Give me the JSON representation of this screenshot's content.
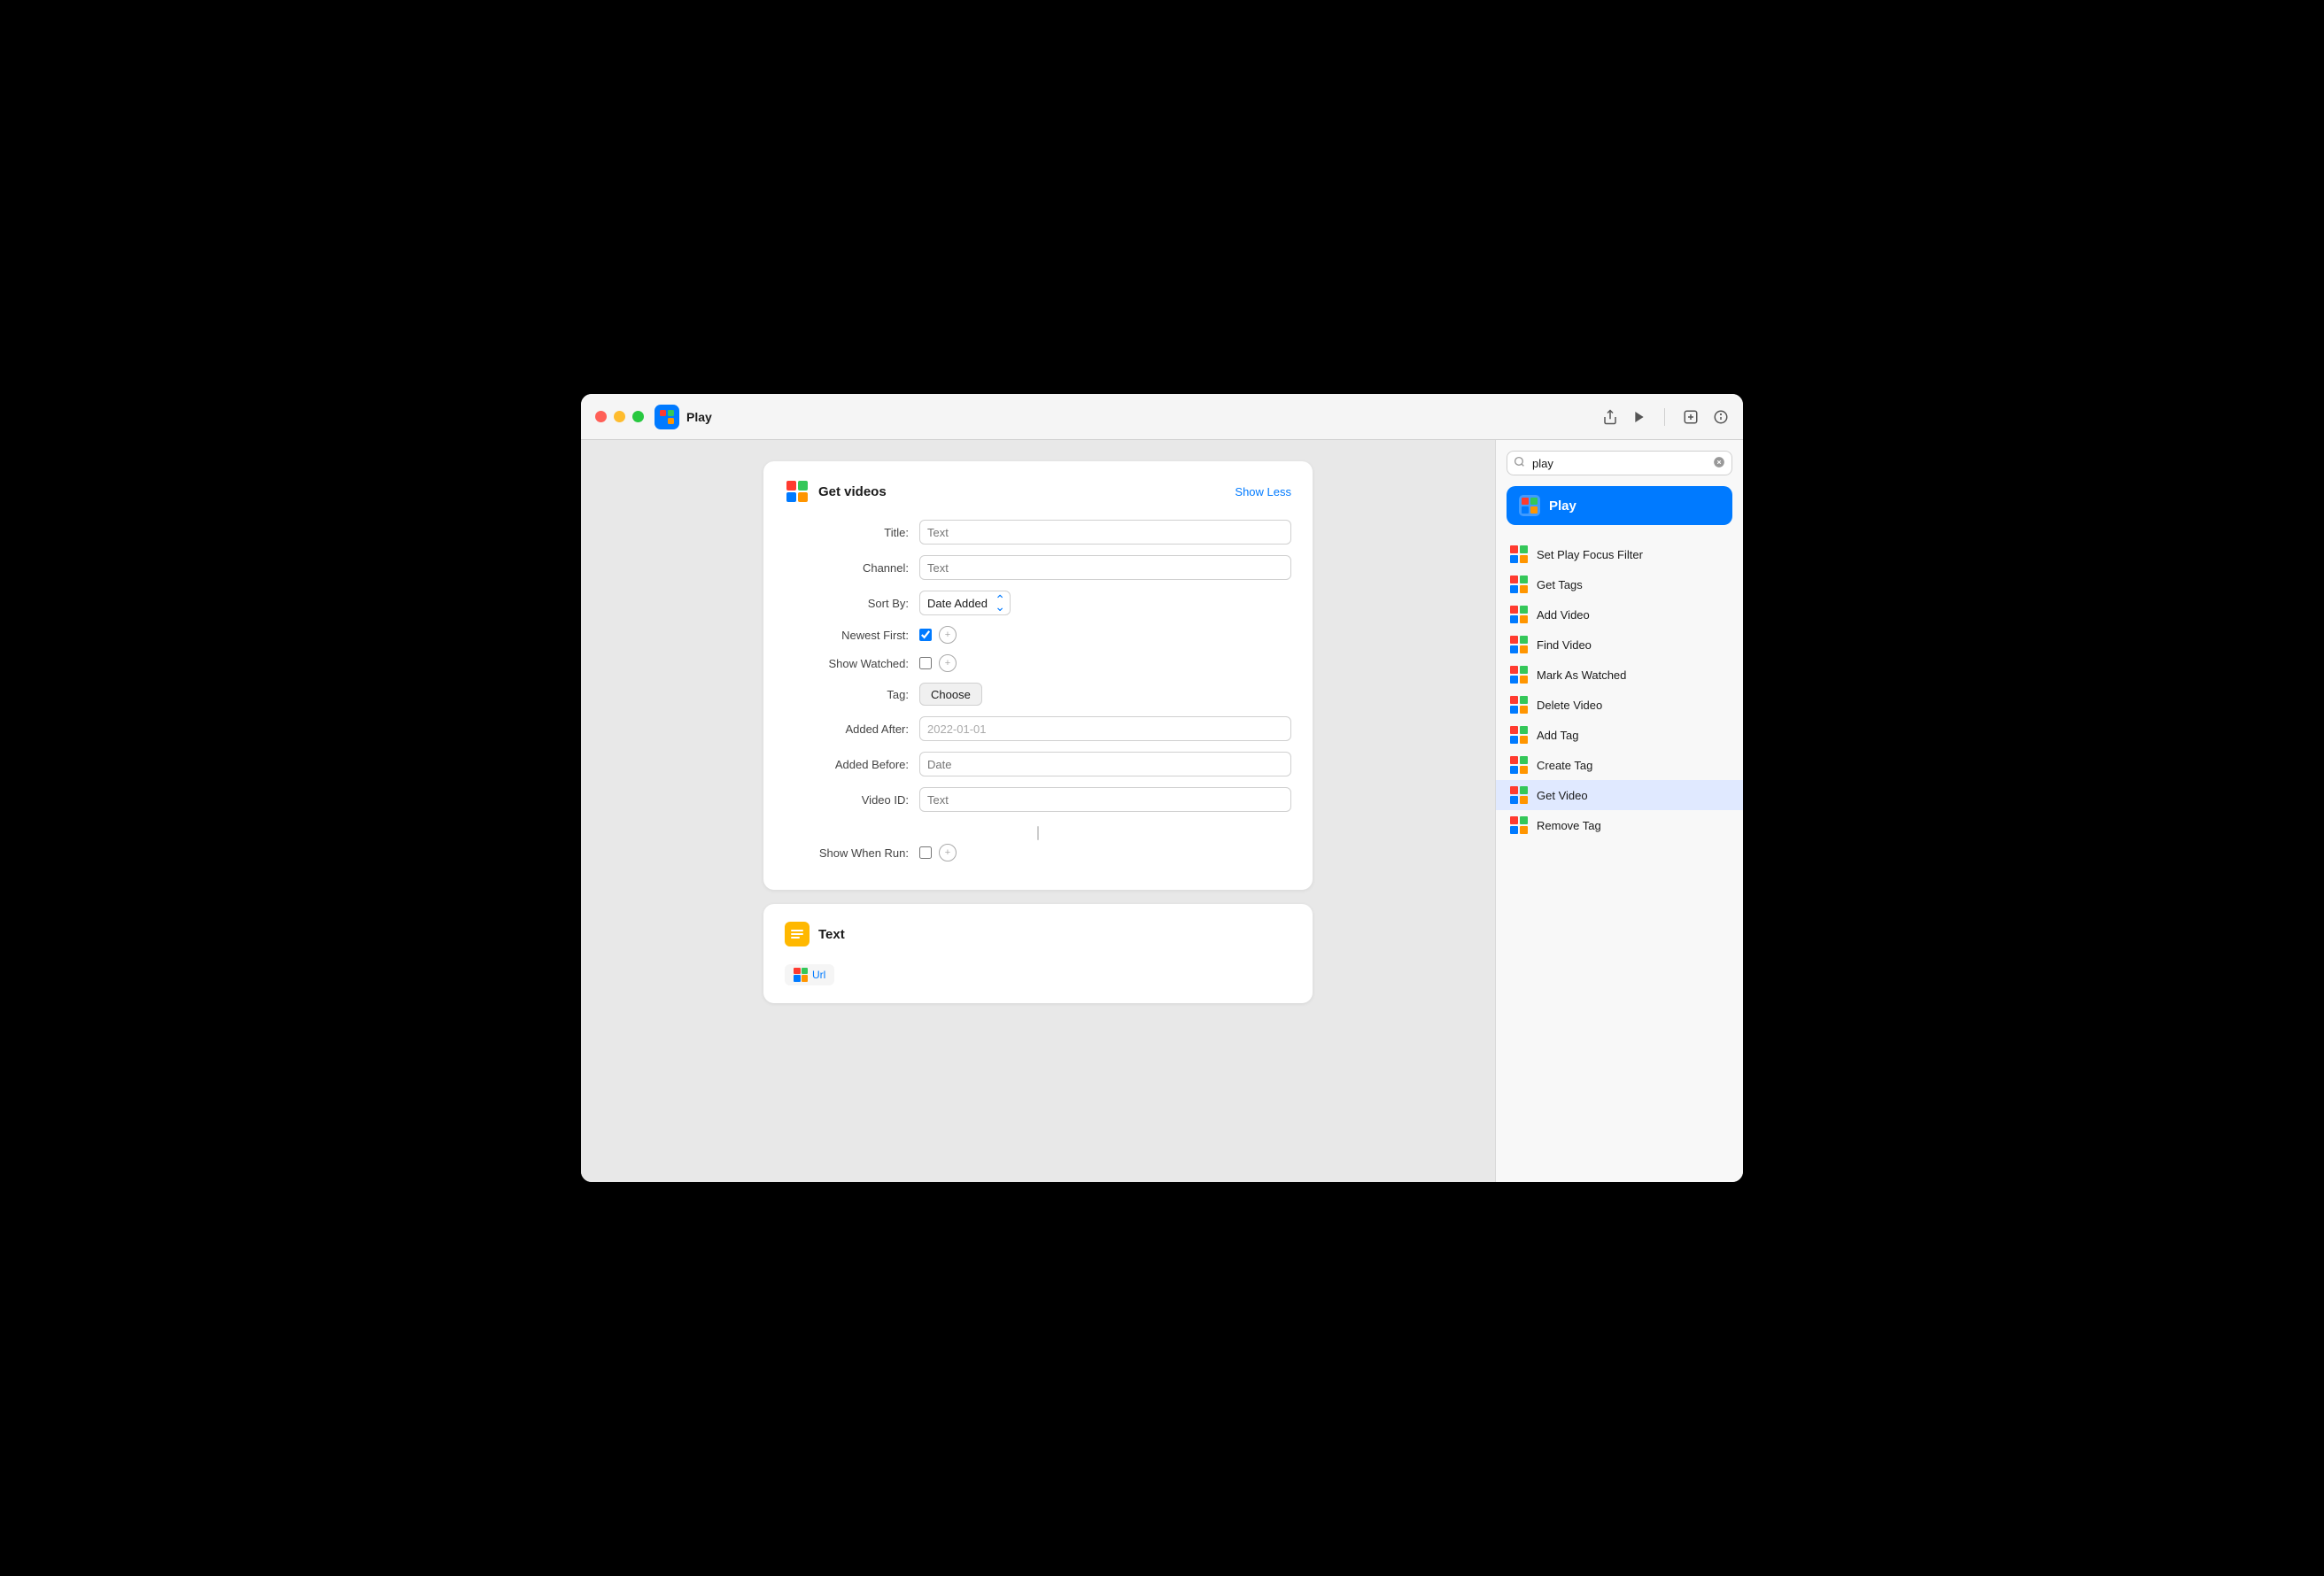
{
  "window": {
    "title": "Play"
  },
  "titlebar": {
    "title": "Play",
    "actions": {
      "share": "⬆",
      "play": "▶"
    }
  },
  "card_get_videos": {
    "title": "Get videos",
    "show_less": "Show Less",
    "fields": {
      "title_label": "Title:",
      "title_placeholder": "Text",
      "channel_label": "Channel:",
      "channel_placeholder": "Text",
      "sort_by_label": "Sort By:",
      "sort_by_value": "Date Added",
      "newest_first_label": "Newest First:",
      "show_watched_label": "Show Watched:",
      "tag_label": "Tag:",
      "tag_choose": "Choose",
      "added_after_label": "Added After:",
      "added_after_value": "2022-01-01",
      "added_before_label": "Added Before:",
      "added_before_placeholder": "Date",
      "video_id_label": "Video ID:",
      "video_id_placeholder": "Text",
      "show_when_run_label": "Show When Run:"
    }
  },
  "card_text": {
    "title": "Text",
    "url_chip": "Url"
  },
  "sidebar": {
    "search_placeholder": "play",
    "search_value": "play",
    "play_button": "Play",
    "items": [
      {
        "label": "Set Play Focus Filter"
      },
      {
        "label": "Get Tags"
      },
      {
        "label": "Add Video"
      },
      {
        "label": "Find Video"
      },
      {
        "label": "Mark As Watched"
      },
      {
        "label": "Delete Video"
      },
      {
        "label": "Add Tag"
      },
      {
        "label": "Create Tag"
      },
      {
        "label": "Get Video"
      },
      {
        "label": "Remove Tag"
      }
    ]
  }
}
